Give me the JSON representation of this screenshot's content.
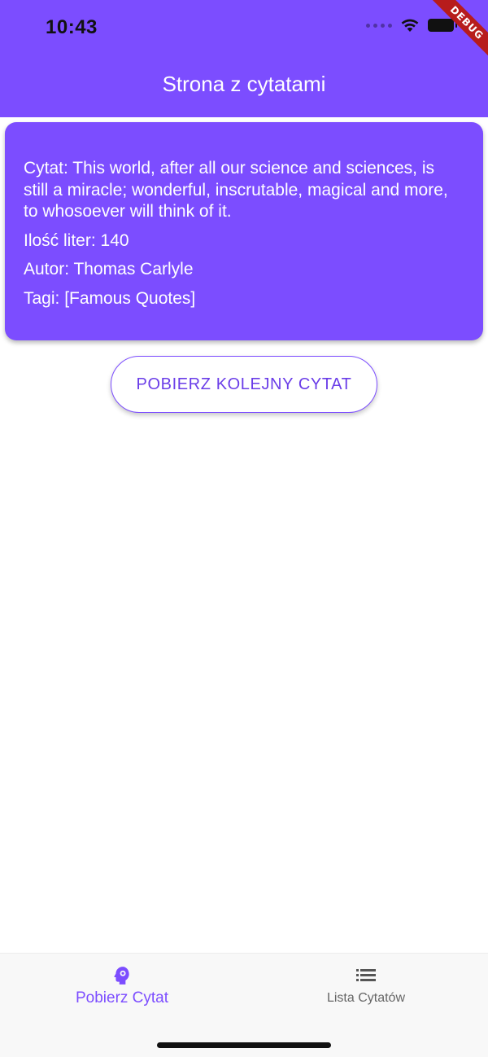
{
  "status_bar": {
    "time": "10:43"
  },
  "debug_banner": "DEBUG",
  "app_bar": {
    "title": "Strona z cytatami"
  },
  "quote_card": {
    "quote": "Cytat: This world, after all our science and sciences, is still a miracle; wonderful, inscrutable, magical and more, to whosoever will think of it.",
    "letter_count": "Ilość liter: 140",
    "author": "Autor: Thomas Carlyle",
    "tags": "Tagi: [Famous Quotes]"
  },
  "actions": {
    "next_quote_label": "POBIERZ KOLEJNY CYTAT"
  },
  "bottom_nav": {
    "items": [
      {
        "label": "Pobierz Cytat",
        "icon": "psychology-head-icon",
        "active": true
      },
      {
        "label": "Lista Cytatów",
        "icon": "list-icon",
        "active": false
      }
    ]
  },
  "colors": {
    "primary": "#7c4dff",
    "on_primary": "#ffffff",
    "button_text": "#6a3de8",
    "nav_background": "#f8f8f8",
    "nav_inactive": "#666666"
  }
}
